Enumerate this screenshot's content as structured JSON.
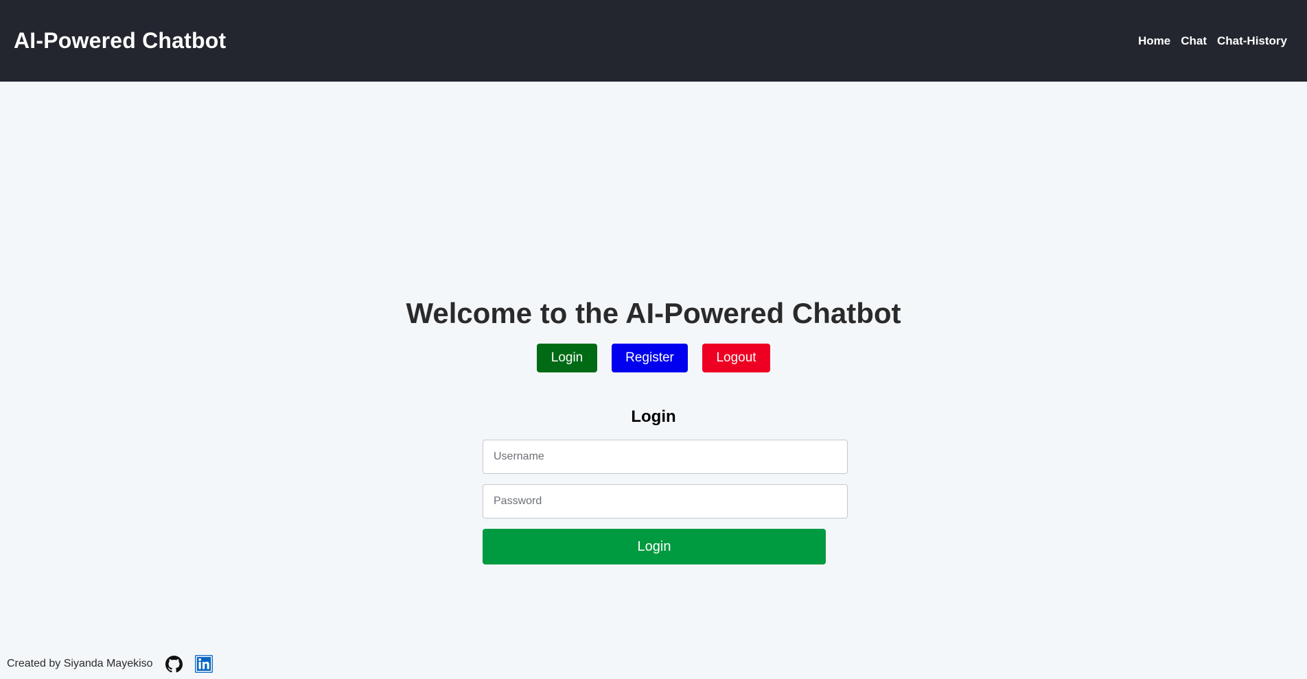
{
  "header": {
    "brand": "AI-Powered Chatbot",
    "nav": [
      "Home",
      "Chat",
      "Chat-History"
    ]
  },
  "hero": {
    "title": "Welcome to the AI-Powered Chatbot",
    "buttons": {
      "login": "Login",
      "register": "Register",
      "logout": "Logout"
    }
  },
  "login_form": {
    "title": "Login",
    "username_placeholder": "Username",
    "password_placeholder": "Password",
    "submit_label": "Login"
  },
  "footer": {
    "credit": "Created by Siyanda Mayekiso",
    "icons": [
      "github-icon",
      "linkedin-icon"
    ]
  },
  "colors": {
    "header_bg": "#23262f",
    "page_bg": "#f4f7fa",
    "login_button": "#006b14",
    "register_button": "#0000ee",
    "logout_button": "#ee0022",
    "submit_button": "#009a40",
    "linkedin_blue": "#0a66c2"
  }
}
